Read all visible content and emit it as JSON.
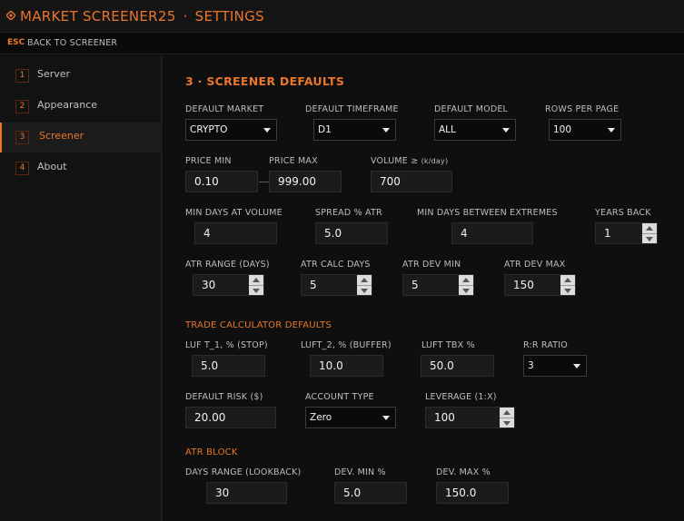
{
  "header": {
    "app_title": "MARKET SCREENER25",
    "separator": "·",
    "page_title": "SETTINGS",
    "esc_key": "ESC",
    "back_label": "BACK TO SCREENER",
    "accent_color": "#e8762c"
  },
  "sidebar": {
    "items": [
      {
        "num": "1",
        "label": "Server"
      },
      {
        "num": "2",
        "label": "Appearance"
      },
      {
        "num": "3",
        "label": "Screener",
        "active": true
      },
      {
        "num": "4",
        "label": "About"
      }
    ]
  },
  "screener": {
    "section_title": "3 · SCREENER DEFAULTS",
    "default_market": {
      "label": "DEFAULT MARKET",
      "value": "CRYPTO"
    },
    "default_timeframe": {
      "label": "DEFAULT TIMEFRAME",
      "value": "D1"
    },
    "default_model": {
      "label": "DEFAULT MODEL",
      "value": "ALL"
    },
    "rows_per_page": {
      "label": "ROWS PER PAGE",
      "value": "100"
    },
    "price_min": {
      "label": "PRICE MIN",
      "value": "0.10"
    },
    "price_max": {
      "label": "PRICE MAX",
      "value": "999.00"
    },
    "volume": {
      "label": "VOLUME ≥",
      "unit": "(k/day)",
      "value": "700"
    },
    "min_days_volume": {
      "label": "MIN DAYS AT VOLUME",
      "value": "4"
    },
    "spread_atr": {
      "label": "SPREAD % ATR",
      "value": "5.0"
    },
    "min_days_extremes": {
      "label": "MIN DAYS BETWEEN EXTREMES",
      "value": "4"
    },
    "years_back": {
      "label": "YEARS BACK",
      "value": "1"
    },
    "atr_range": {
      "label": "ATR RANGE (DAYS)",
      "value": "30"
    },
    "atr_calc_days": {
      "label": "ATR CALC DAYS",
      "value": "5"
    },
    "atr_dev_min": {
      "label": "ATR DEV MIN",
      "value": "5"
    },
    "atr_dev_max": {
      "label": "ATR DEV MAX",
      "value": "150"
    }
  },
  "trade_calc": {
    "section_title": "TRADE CALCULATOR DEFAULTS",
    "luf_t1": {
      "label": "LUF T_1, % (STOP)",
      "value": "5.0"
    },
    "luft_2": {
      "label": "LUFT_2, % (BUFFER)",
      "value": "10.0"
    },
    "luft_tbx": {
      "label": "LUFT TBX %",
      "value": "50.0"
    },
    "rr_ratio": {
      "label": "R:R RATIO",
      "value": "3"
    },
    "default_risk": {
      "label": "DEFAULT RISK ($)",
      "value": "20.00"
    },
    "account_type": {
      "label": "ACCOUNT TYPE",
      "value": "Zero"
    },
    "leverage": {
      "label": "LEVERAGE (1:X)",
      "value": "100"
    }
  },
  "atr_block": {
    "section_title": "ATR BLOCK",
    "days_range": {
      "label": "DAYS RANGE (LOOKBACK)",
      "value": "30"
    },
    "dev_min": {
      "label": "DEV. MIN %",
      "value": "5.0"
    },
    "dev_max": {
      "label": "DEV. MAX %",
      "value": "150.0"
    }
  }
}
